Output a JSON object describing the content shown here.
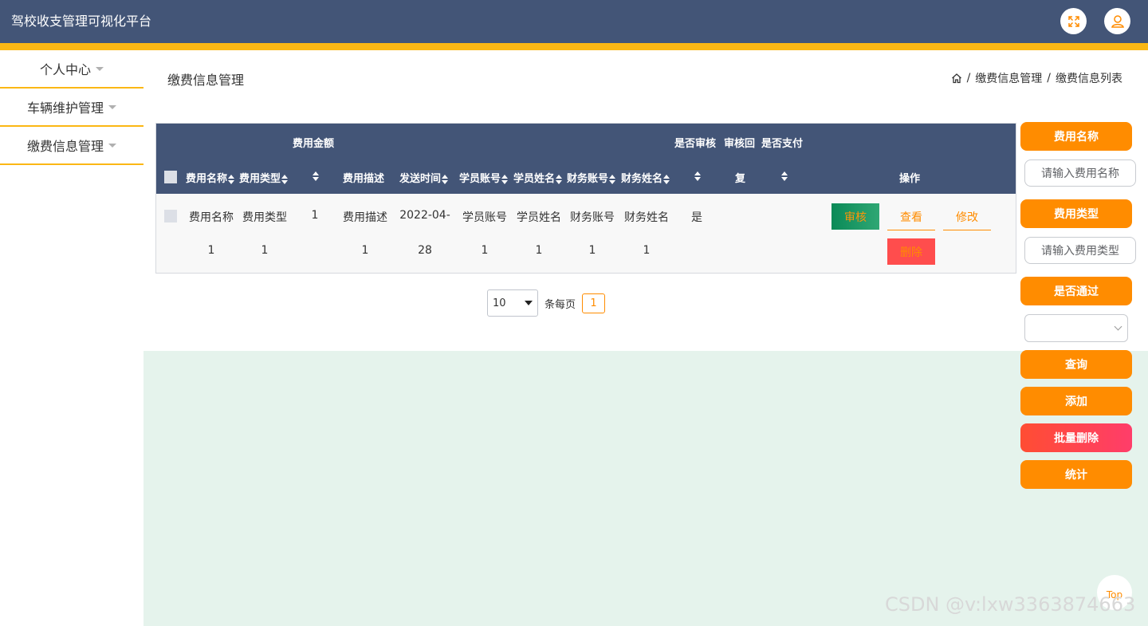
{
  "app": {
    "title": "驾校收支管理可视化平台"
  },
  "header": {
    "fullscreen_icon": "fullscreen-icon",
    "user_icon": "user-icon"
  },
  "sidebar": {
    "items": [
      {
        "label": "个人中心"
      },
      {
        "label": "车辆维护管理"
      },
      {
        "label": "缴费信息管理"
      }
    ]
  },
  "page": {
    "title": "缴费信息管理"
  },
  "breadcrumb": {
    "home_icon": "home-icon",
    "sep": "/",
    "items": [
      "缴费信息管理",
      "缴费信息列表"
    ]
  },
  "table": {
    "headers": {
      "fee_amount": "费用金额",
      "fee_name": "费用名称",
      "fee_type": "费用类型",
      "fee_desc": "费用描述",
      "send_time": "发送时间",
      "student_account": "学员账号",
      "student_name": "学员姓名",
      "finance_account": "财务账号",
      "finance_name": "财务姓名",
      "is_reviewed": "是否审核",
      "review_reply_top": "审核回",
      "review_reply_bottom": "复",
      "is_paid": "是否支付",
      "actions": "操作"
    },
    "row": {
      "fee_name": [
        "费用名称",
        "1"
      ],
      "fee_type": [
        "费用类型",
        "1"
      ],
      "fee_amount": "1",
      "fee_desc": [
        "费用描述",
        "1"
      ],
      "send_time": [
        "2022-04-",
        "28"
      ],
      "student_account": [
        "学员账号",
        "1"
      ],
      "student_name": [
        "学员姓名",
        "1"
      ],
      "finance_account": [
        "财务账号",
        "1"
      ],
      "finance_name": [
        "财务姓名",
        "1"
      ],
      "is_reviewed": "是",
      "actions": {
        "approve": "审核",
        "view": "查看",
        "edit": "修改",
        "delete": "删除"
      }
    }
  },
  "pagination": {
    "page_size": "10",
    "per_page_label": "条每页",
    "current_page": "1"
  },
  "search_panel": {
    "fee_name_label": "费用名称",
    "fee_name_placeholder": "请输入费用名称",
    "fee_type_label": "费用类型",
    "fee_type_placeholder": "请输入费用类型",
    "passed_label": "是否通过",
    "query_button": "查询",
    "add_button": "添加",
    "batch_delete_button": "批量删除",
    "stats_button": "统计"
  },
  "back_to_top": "Top",
  "watermark": "CSDN @v:lxw3363874663",
  "colors": {
    "header_bg": "#435577",
    "accent": "#fbb714",
    "primary": "#ff8c00",
    "danger": "#ff4d4d",
    "content_bg": "#e5f3ec"
  }
}
